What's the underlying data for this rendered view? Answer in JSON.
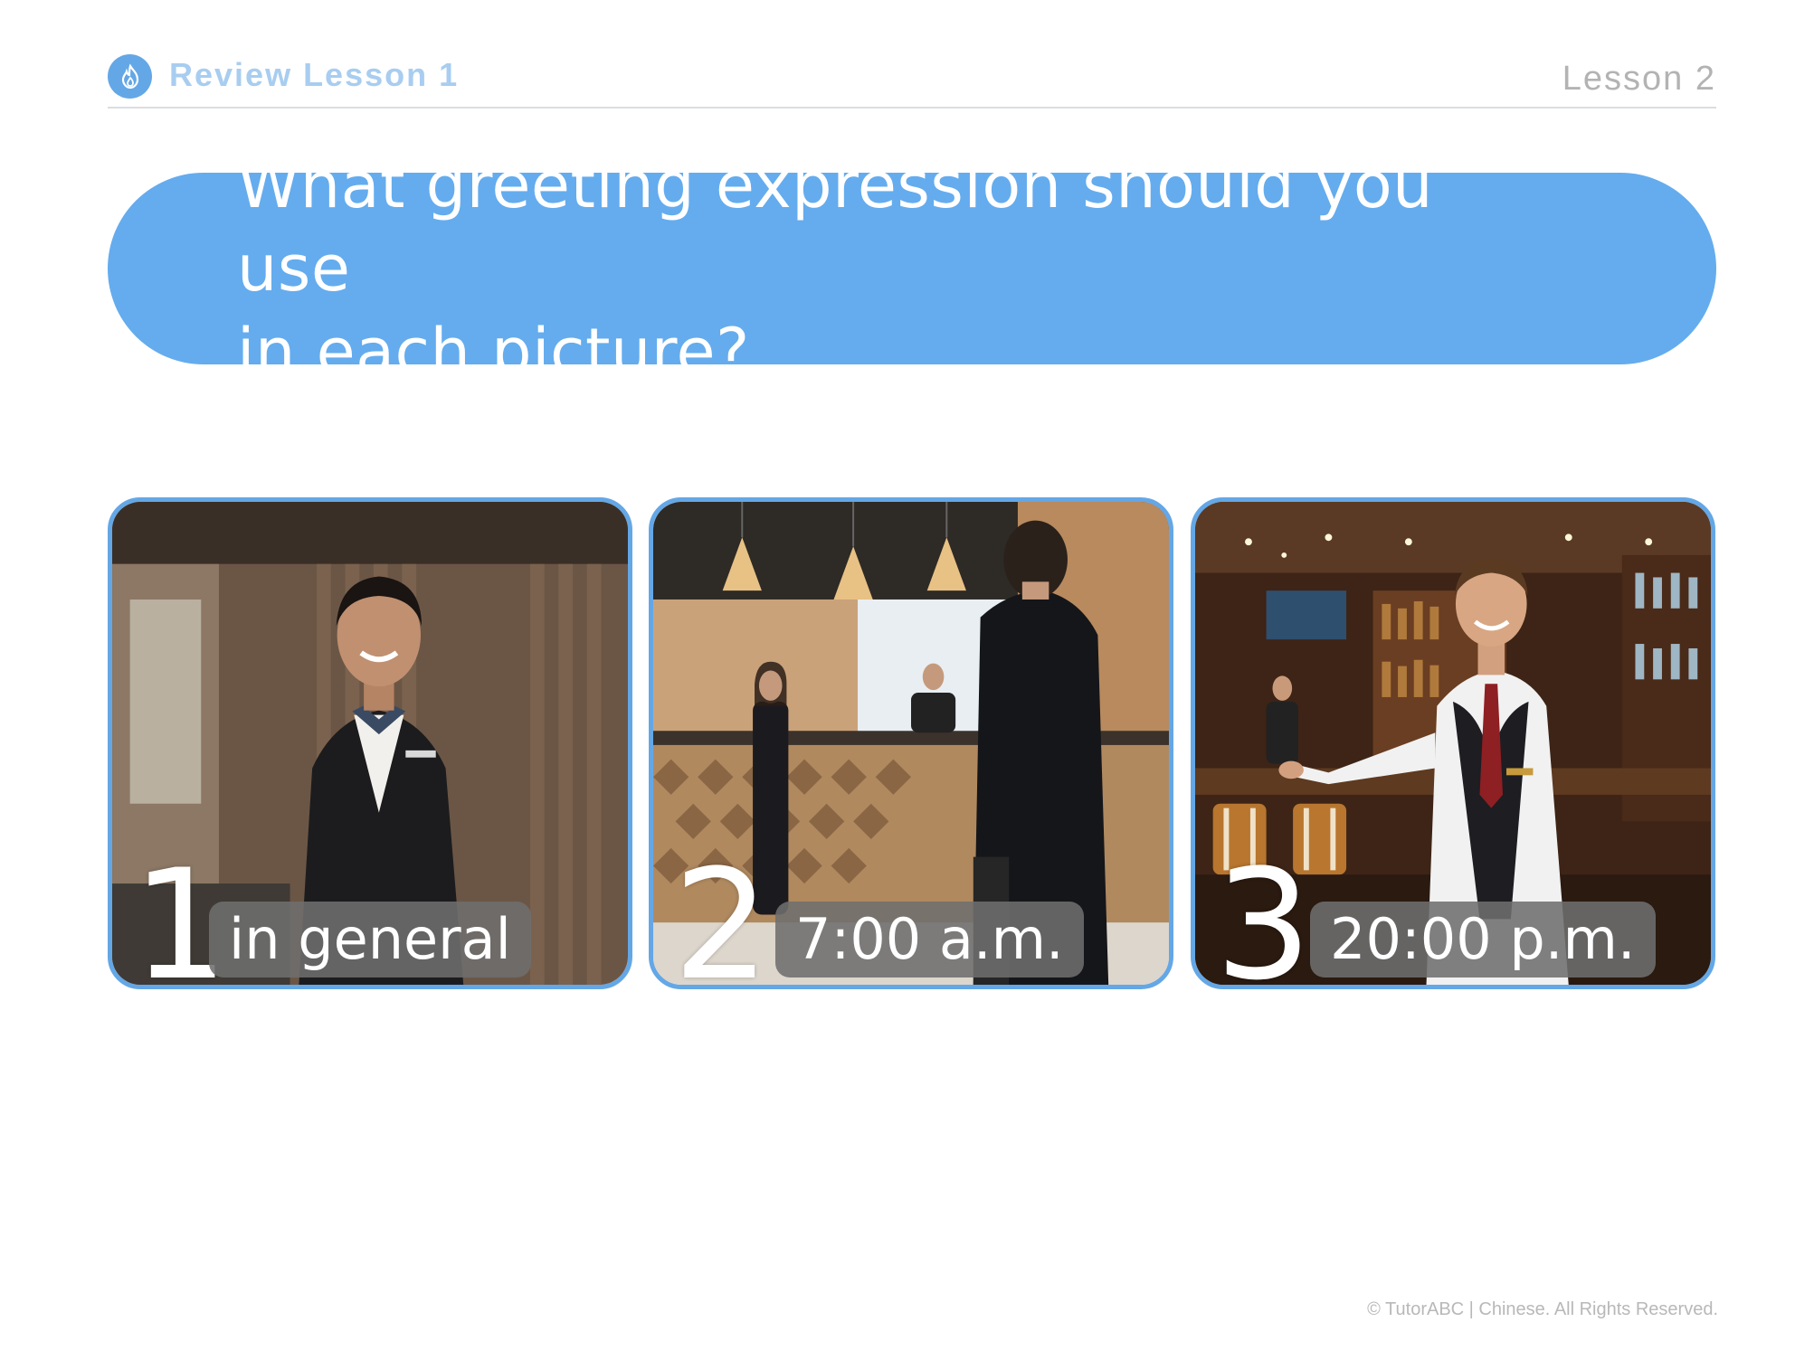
{
  "header": {
    "icon": "flame-icon",
    "title": "Review Lesson 1",
    "lesson": "Lesson 2"
  },
  "question": {
    "line1": "What greeting expression should you use",
    "line2": "in each picture?"
  },
  "cards": [
    {
      "number": "1",
      "caption": "in general",
      "image": "hotel-receptionist-photo"
    },
    {
      "number": "2",
      "caption": "7:00 a.m.",
      "image": "hotel-lobby-checkin-photo"
    },
    {
      "number": "3",
      "caption": "20:00 p.m.",
      "image": "bar-waiter-photo"
    }
  ],
  "footer": {
    "copyright": "© TutorABC | Chinese. All Rights Reserved."
  },
  "colors": {
    "accent": "#64acee",
    "header_title": "#a8cdf0",
    "muted": "#b3b3b3"
  }
}
